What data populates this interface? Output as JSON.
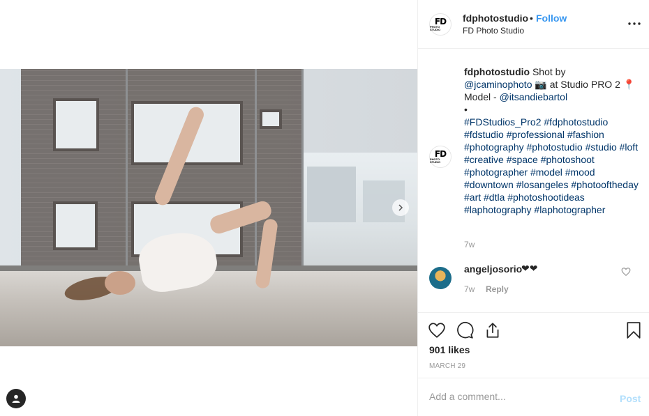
{
  "post": {
    "username": "fdphotostudio",
    "separator": "•",
    "follow_label": "Follow",
    "location": "FD Photo Studio",
    "logo_text": "FD",
    "logo_subtext": "PHOTO STUDIO"
  },
  "caption": {
    "username": "fdphotostudio",
    "line1": " Shot by",
    "mention1": "@jcaminophoto",
    "line2": " 📷 at Studio PRO 2 📍",
    "line3": "Model - ",
    "mention2": "@itsandiebartol",
    "bullet": "•",
    "hashtags": "#FDStudios_Pro2 #fdphotostudio #fdstudio #professional #fashion #photography #photostudio #studio #loft #creative #space #photoshoot #photographer #model #mood #downtown #losangeles #photooftheday #art #dtla #photoshootideas #laphotography #laphotographer",
    "time": "7w"
  },
  "comment": {
    "username": "angeljosorio",
    "text": "❤❤",
    "time": "7w",
    "reply_label": "Reply"
  },
  "likes": "901 likes",
  "date": "MARCH 29",
  "add_comment": {
    "placeholder": "Add a comment...",
    "post_label": "Post"
  },
  "icons": {
    "like": "heart-icon",
    "comment": "comment-icon",
    "share": "share-icon",
    "save": "bookmark-icon",
    "more": "more-options-icon",
    "next": "chevron-right-icon",
    "profile": "user-icon"
  },
  "colors": {
    "follow": "#3897f0",
    "post_disabled": "#b2dffc",
    "meta": "#999999",
    "link": "#003569"
  }
}
